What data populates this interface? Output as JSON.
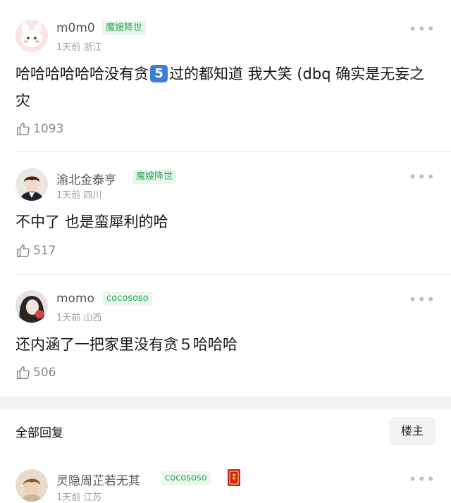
{
  "comments": [
    {
      "username": "m0m0",
      "badge": "魔嫂降世",
      "meta": "1天前 浙江",
      "text_part1": "哈哈哈哈哈哈没有贪",
      "text_num": "5",
      "text_part2": "过的都知道 我大笑 (dbq 确实是无妄之灾",
      "likes": "1093"
    },
    {
      "username": "渝北金泰亨",
      "badge": "魔嫂降世",
      "meta": "1天前 四川",
      "text": "不中了 也是蛮犀利的哈",
      "likes": "517"
    },
    {
      "username": "momo",
      "badge": "cocososo",
      "meta": "1天前 山西",
      "text": "还内涵了一把家里没有贪５哈哈哈",
      "likes": "506"
    }
  ],
  "replies": {
    "header": "全部回复",
    "op_button": "楼主",
    "first_reply": {
      "username": "灵隐周芷若无其",
      "badge": "cocososo",
      "meta": "1天前 江苏"
    }
  },
  "icons": {
    "more": "more-dots-icon",
    "like": "thumbs-up-icon",
    "medal": "red-medal-icon"
  },
  "colors": {
    "badge_text": "#2fa84f",
    "badge_bg": "#eaf7ee",
    "number_tile": "#3d7fd6"
  }
}
